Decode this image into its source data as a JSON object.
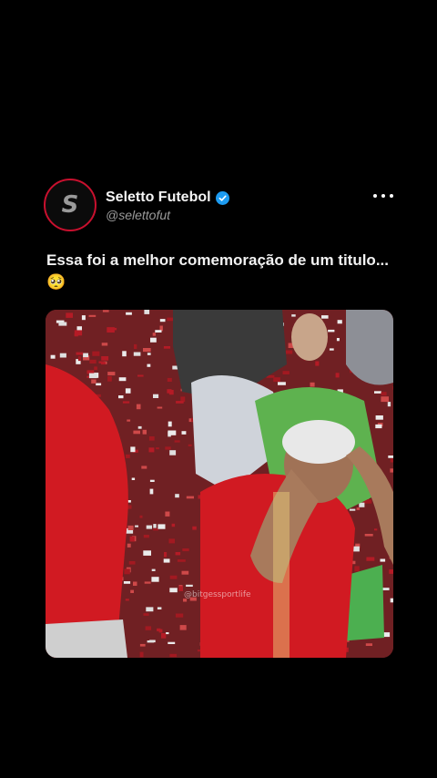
{
  "tweet": {
    "display_name": "Seletto Futebol",
    "handle": "@selettofut",
    "text": "Essa foi a melhor comemoração de um titulo... 🥺",
    "avatar_letter": "S",
    "verified": true,
    "more_icon": "more-horizontal-icon"
  },
  "media": {
    "watermark": "@bitgessportlife",
    "colors": {
      "confetti_red": "#c41e2a",
      "confetti_white": "#f2f2f2",
      "jersey_red": "#d11a22",
      "vest_green": "#4caf50"
    }
  },
  "colors": {
    "background": "#000000",
    "avatar_ring": "#c8102e",
    "verified_blue": "#1d9bf0",
    "handle_gray": "#9b9b9b"
  }
}
